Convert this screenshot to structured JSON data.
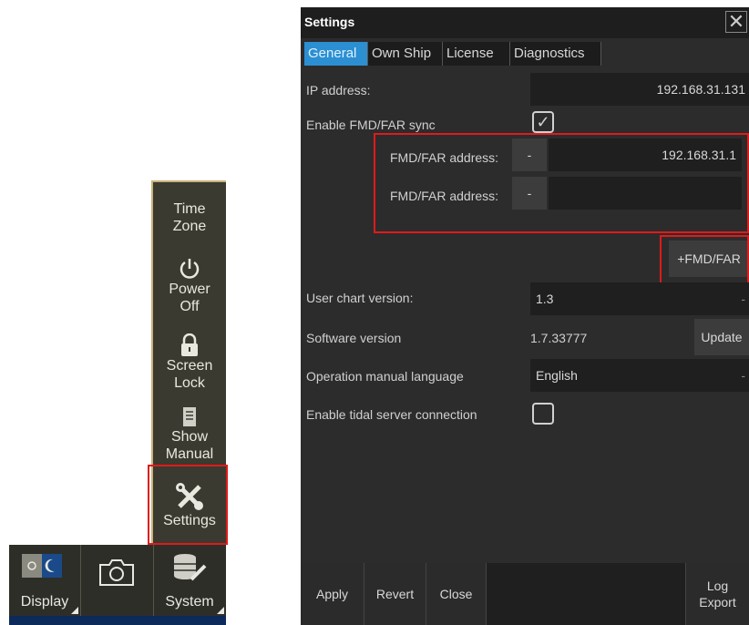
{
  "side_menu": {
    "items": [
      {
        "label1": "Time",
        "label2": "Zone",
        "icon": "time-zone"
      },
      {
        "label1": "Power",
        "label2": "Off",
        "icon": "power-icon"
      },
      {
        "label1": "Screen",
        "label2": "Lock",
        "icon": "lock-icon"
      },
      {
        "label1": "Show",
        "label2": "Manual",
        "icon": "manual-icon"
      },
      {
        "label1": "Settings",
        "icon": "wrench-screwdriver-icon"
      }
    ]
  },
  "bottom_bar": {
    "items": [
      {
        "label": "Display",
        "icon": "day-night-icon"
      },
      {
        "label": "",
        "icon": "camera-icon"
      },
      {
        "label": "System",
        "icon": "database-wrench-icon"
      }
    ]
  },
  "dialog": {
    "title": "Settings",
    "close_glyph": "✕",
    "tabs": [
      {
        "label": "General",
        "active": true
      },
      {
        "label": "Own Ship",
        "active": false
      },
      {
        "label": "License",
        "active": false
      },
      {
        "label": "Diagnostics",
        "active": false
      }
    ],
    "ip_address": {
      "label": "IP address:",
      "value": "192.168.31.131"
    },
    "fmd_sync": {
      "label": "Enable FMD/FAR sync",
      "checked": true
    },
    "fmd_addresses": [
      {
        "label": "FMD/FAR address:",
        "remove": "-",
        "value": "192.168.31.1"
      },
      {
        "label": "FMD/FAR address:",
        "remove": "-",
        "value": ""
      }
    ],
    "add_fmd_label": "+FMD/FAR",
    "user_chart": {
      "label": "User chart version:",
      "value": "1.3"
    },
    "software": {
      "label": "Software version",
      "value": "1.7.33777",
      "update": "Update"
    },
    "manual_language": {
      "label": "Operation manual language",
      "value": "English"
    },
    "tidal": {
      "label": "Enable tidal server connection",
      "checked": false
    },
    "footer": {
      "apply": "Apply",
      "revert": "Revert",
      "close": "Close",
      "log1": "Log",
      "log2": "Export"
    }
  },
  "colors": {
    "accent": "#2b8fd2",
    "highlight": "#e01a1a",
    "menu_border": "#c9b27a"
  }
}
